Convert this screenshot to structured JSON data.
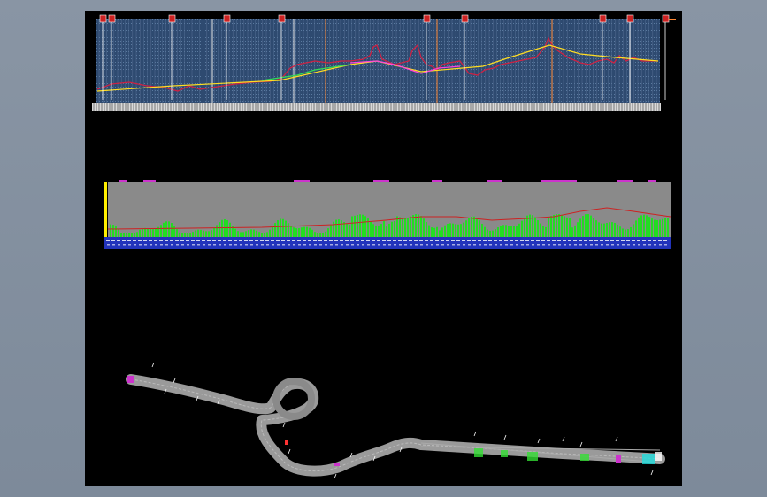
{
  "viewer": {
    "background_color": "#7f8c9c",
    "canvas_color": "#000000"
  },
  "drawing_sheets": [
    {
      "name": "longitudinal-profile",
      "grid_color": "#3b5a80",
      "tag_color": "#cc2222",
      "station_markers": 12
    },
    {
      "name": "cross-section-profile",
      "fill_color": "#8a8a8a",
      "bars_color": "#22dd22",
      "datum_band_color": "#2222cc"
    },
    {
      "name": "route-plan-view",
      "corridor_color": "#9a9a9a"
    }
  ]
}
